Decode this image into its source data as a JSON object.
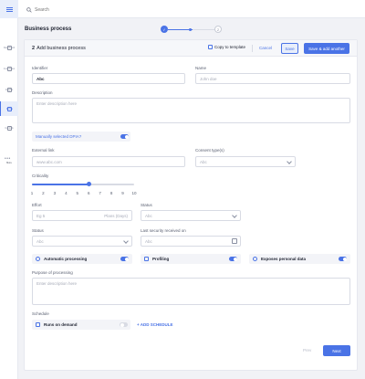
{
  "search": {
    "placeholder": "Search"
  },
  "sidebar": {
    "items": [
      {
        "label": "Dashboard",
        "icon": "dashboard-icon",
        "active": false
      },
      {
        "label": "Inventories",
        "icon": "inventory-icon",
        "active": false
      },
      {
        "label": "Insights",
        "icon": "insights-icon",
        "active": false
      },
      {
        "label": "Forms",
        "icon": "forms-icon",
        "active": true
      },
      {
        "label": "Controls",
        "icon": "controls-icon",
        "active": false
      }
    ],
    "more_label": "More"
  },
  "page_title": "Business process",
  "stepper": {
    "step1": "✓",
    "step2": "2"
  },
  "card": {
    "step_number": "2",
    "title": "Add business process",
    "copy_label": "Copy to template",
    "cancel_label": "Cancel",
    "save_label": "Save",
    "save_add_label": "Save & add another"
  },
  "form": {
    "identifier": {
      "label": "Identifier",
      "value": "Abc"
    },
    "name": {
      "label": "Name",
      "placeholder": "John doe"
    },
    "description": {
      "label": "Description",
      "placeholder": "Enter description here"
    },
    "manual_dpia": {
      "label": "Manually selected DPIA?",
      "on": true
    },
    "external_link": {
      "label": "External link",
      "placeholder": "www.abc.com"
    },
    "consent_types": {
      "label": "Consent type(s)",
      "placeholder": "Abc"
    },
    "criticality": {
      "label": "Criticality",
      "ticks": [
        "1",
        "2",
        "3",
        "4",
        "5",
        "6",
        "7",
        "8",
        "9",
        "10"
      ],
      "value": 6,
      "max": 10
    },
    "effort": {
      "label": "Effort",
      "placeholder": "Eg 5",
      "suffix": "Plans (Days)"
    },
    "status_right": {
      "label": "Status",
      "placeholder": "Abc"
    },
    "status_left": {
      "label": "Status",
      "placeholder": "Abc"
    },
    "last_security": {
      "label": "Last security received on",
      "placeholder": "Abc"
    },
    "automatic_processing": {
      "label": "Automatic processing",
      "icon": "gear-icon",
      "on": true
    },
    "profiling": {
      "label": "Profiling",
      "icon": "list-icon",
      "on": true
    },
    "personal_data": {
      "label": "Exposes personal data",
      "icon": "eye-icon",
      "on": true
    },
    "purpose": {
      "label": "Purpose of processing",
      "placeholder": "Enter description here"
    },
    "schedule": {
      "label": "Schedule",
      "runs_on_demand": "Runs on demand",
      "on": false,
      "add_schedule": "+ ADD SCHEDULE"
    }
  },
  "footer": {
    "prev_label": "Prev",
    "next_label": "Next"
  },
  "colors": {
    "accent": "#4a73e6",
    "background": "#f1f2f6"
  }
}
